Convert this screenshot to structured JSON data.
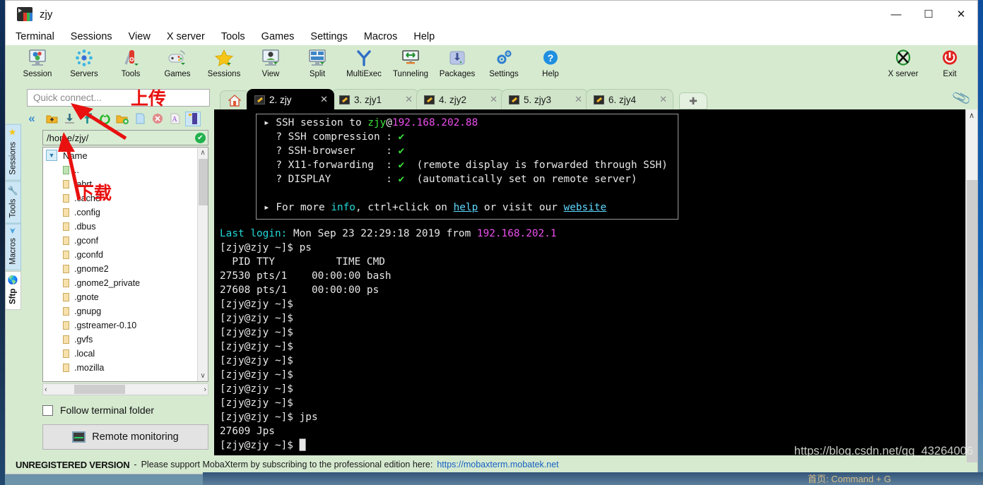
{
  "window": {
    "title": "zjy",
    "minimize": "—",
    "maximize": "☐",
    "close": "✕"
  },
  "menubar": {
    "items": [
      "Terminal",
      "Sessions",
      "View",
      "X server",
      "Tools",
      "Games",
      "Settings",
      "Macros",
      "Help"
    ]
  },
  "toolbar": {
    "buttons": [
      {
        "label": "Session",
        "icon": "session-icon"
      },
      {
        "label": "Servers",
        "icon": "servers-icon"
      },
      {
        "label": "Tools",
        "icon": "tools-icon"
      },
      {
        "label": "Games",
        "icon": "games-icon"
      },
      {
        "label": "Sessions",
        "icon": "sessions-star-icon"
      },
      {
        "label": "View",
        "icon": "view-icon"
      },
      {
        "label": "Split",
        "icon": "split-icon"
      },
      {
        "label": "MultiExec",
        "icon": "multiexec-icon"
      },
      {
        "label": "Tunneling",
        "icon": "tunneling-icon"
      },
      {
        "label": "Packages",
        "icon": "packages-icon"
      },
      {
        "label": "Settings",
        "icon": "settings-gear-icon"
      },
      {
        "label": "Help",
        "icon": "help-question-icon"
      }
    ],
    "right_buttons": [
      {
        "label": "X server",
        "icon": "x-server-icon"
      },
      {
        "label": "Exit",
        "icon": "power-exit-icon"
      }
    ]
  },
  "sidebar": {
    "tabs": [
      {
        "label": "Sessions",
        "icon": "star-icon",
        "active": false
      },
      {
        "label": "Tools",
        "icon": "wrench-icon",
        "active": false
      },
      {
        "label": "Macros",
        "icon": "paper-plane-icon",
        "active": false
      },
      {
        "label": "Sftp",
        "icon": "globe-icon",
        "active": true
      }
    ],
    "collapse_icon": "«"
  },
  "sftp": {
    "quick_connect_placeholder": "Quick connect...",
    "toolbar_icons": [
      "parent-folder-icon",
      "download-icon",
      "upload-icon",
      "refresh-icon",
      "new-folder-icon",
      "new-file-icon",
      "delete-icon",
      "rename-icon",
      "bookmark-icon"
    ],
    "path": "/home/zjy/",
    "path_status": "✔",
    "column_header": "Name",
    "files": [
      "..",
      ".abrt",
      ".cache",
      ".config",
      ".dbus",
      ".gconf",
      ".gconfd",
      ".gnome2",
      ".gnome2_private",
      ".gnote",
      ".gnupg",
      ".gstreamer-0.10",
      ".gvfs",
      ".local",
      ".mozilla"
    ],
    "follow_terminal_folder": "Follow terminal folder",
    "follow_checked": false,
    "remote_monitoring": "Remote monitoring",
    "scroll_up": "∧",
    "scroll_down": "∨",
    "scroll_left": "‹",
    "scroll_right": "›"
  },
  "tabs": {
    "home_icon": "home-icon",
    "items": [
      {
        "label": "2. zjy",
        "active": true
      },
      {
        "label": "3. zjy1",
        "active": false
      },
      {
        "label": "4. zjy2",
        "active": false
      },
      {
        "label": "5. zjy3",
        "active": false
      },
      {
        "label": "6. zjy4",
        "active": false
      }
    ],
    "close_glyph": "✕",
    "new_tab_glyph": "✚",
    "attach_icon": "paperclip-icon"
  },
  "terminal": {
    "info_box": {
      "line1_prefix": "▸ SSH session to ",
      "user": "zjy",
      "at": "@",
      "host": "192.168.202.88",
      "rows": [
        {
          "label": "? SSH compression :",
          "check": "✔",
          "note": ""
        },
        {
          "label": "? SSH-browser     :",
          "check": "✔",
          "note": ""
        },
        {
          "label": "? X11-forwarding  :",
          "check": "✔",
          "note": "(remote display is forwarded through SSH)"
        },
        {
          "label": "? DISPLAY         :",
          "check": "✔",
          "note": "(automatically set on remote server)"
        }
      ],
      "footer_pre": "▸ For more ",
      "footer_info": "info",
      "footer_mid": ", ctrl+click on ",
      "footer_help": "help",
      "footer_or": " or visit our ",
      "footer_site": "website"
    },
    "last_login_label": "Last login:",
    "last_login_rest": " Mon Sep 23 22:29:18 2019 from ",
    "last_login_ip": "192.168.202.1",
    "prompt": "[zjy@zjy ~]$",
    "lines": [
      {
        "prompt": true,
        "cmd": " ps"
      },
      {
        "prompt": false,
        "cmd": "  PID TTY          TIME CMD"
      },
      {
        "prompt": false,
        "cmd": "27530 pts/1    00:00:00 bash"
      },
      {
        "prompt": false,
        "cmd": "27608 pts/1    00:00:00 ps"
      },
      {
        "prompt": true,
        "cmd": ""
      },
      {
        "prompt": true,
        "cmd": ""
      },
      {
        "prompt": true,
        "cmd": ""
      },
      {
        "prompt": true,
        "cmd": ""
      },
      {
        "prompt": true,
        "cmd": ""
      },
      {
        "prompt": true,
        "cmd": ""
      },
      {
        "prompt": true,
        "cmd": ""
      },
      {
        "prompt": true,
        "cmd": ""
      },
      {
        "prompt": true,
        "cmd": " jps"
      },
      {
        "prompt": false,
        "cmd": "27609 Jps"
      },
      {
        "prompt": true,
        "cmd": " █"
      }
    ],
    "scroll_up": "∧",
    "scroll_down": "∨"
  },
  "annotations": {
    "upload": "上传",
    "download": "下载",
    "color": "#e8110f"
  },
  "footer": {
    "unregistered": "UNREGISTERED VERSION",
    "dash": "-",
    "message": "Please support MobaXterm by subscribing to the professional edition here:",
    "link": "https://mobaxterm.mobatek.net"
  },
  "watermark": "https://blog.csdn.net/qq_43264006",
  "behind_text": "首页: Command + G",
  "colors": {
    "toolbar_bg": "#d6ead0",
    "terminal_bg": "#000000",
    "accent_link": "#1560c4",
    "annotation_red": "#e8110f"
  }
}
